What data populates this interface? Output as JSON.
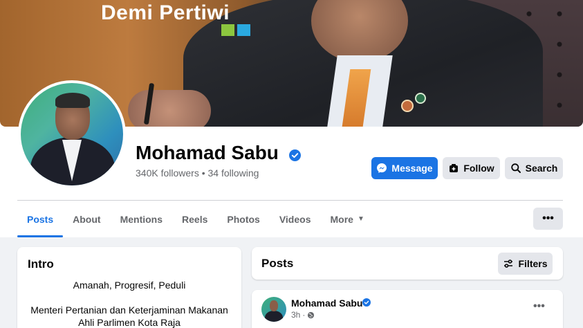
{
  "cover": {
    "text": "Demi Pertiwi"
  },
  "profile": {
    "name": "Mohamad Sabu",
    "followers": "340K followers",
    "separator": "•",
    "following": "34 following"
  },
  "actions": {
    "message": "Message",
    "follow": "Follow",
    "search": "Search"
  },
  "tabs": [
    {
      "label": "Posts",
      "active": true
    },
    {
      "label": "About"
    },
    {
      "label": "Mentions"
    },
    {
      "label": "Reels"
    },
    {
      "label": "Photos"
    },
    {
      "label": "Videos"
    },
    {
      "label": "More"
    }
  ],
  "intro": {
    "title": "Intro",
    "lines": [
      "Amanah, Progresif, Peduli",
      "Menteri Pertanian dan Keterjaminan Makanan",
      "Ahli Parlimen Kota Raja"
    ]
  },
  "posts": {
    "title": "Posts",
    "filters_label": "Filters",
    "items": [
      {
        "author": "Mohamad Sabu",
        "time": "3h",
        "time_separator": "·"
      }
    ]
  },
  "colors": {
    "accent": "#1b74e4",
    "secondary_button": "#e4e6eb",
    "background": "#f0f2f5",
    "muted_text": "#65676b"
  }
}
